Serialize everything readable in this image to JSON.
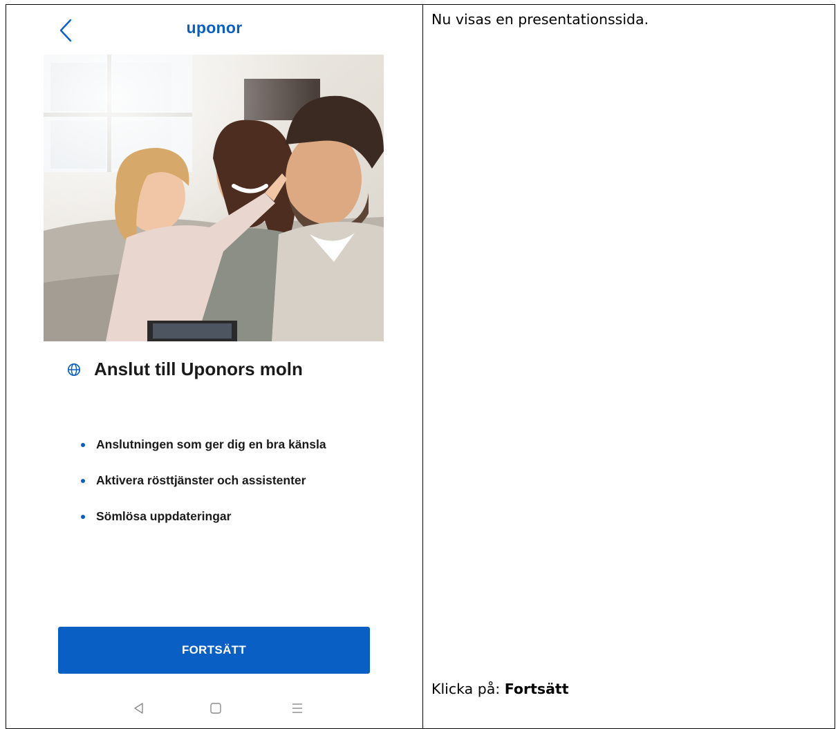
{
  "colors": {
    "brand": "#0a5fc4",
    "button_bg": "#0a5fc4",
    "button_text": "#ffffff",
    "nav_icon": "#8a8a8a"
  },
  "app": {
    "back_icon": "chevron-left-icon",
    "brand_logo": "uponor"
  },
  "hero": {
    "image_description_icon": "family-photo"
  },
  "section": {
    "icon": "globe-icon",
    "title": "Anslut till Uponors moln"
  },
  "features": [
    "Anslutningen som ger dig en bra känsla",
    "Aktivera rösttjänster och assistenter",
    "Sömlösa uppdateringar"
  ],
  "primary_button": {
    "label": "FORTSÄTT"
  },
  "system_nav": {
    "back_icon": "triangle-back-icon",
    "home_icon": "square-home-icon",
    "menu_icon": "menu-lines-icon"
  },
  "instructions": {
    "top_text": "Nu visas en presentationssida.",
    "bottom_prefix": "Klicka på: ",
    "bottom_action": "Fortsätt"
  }
}
